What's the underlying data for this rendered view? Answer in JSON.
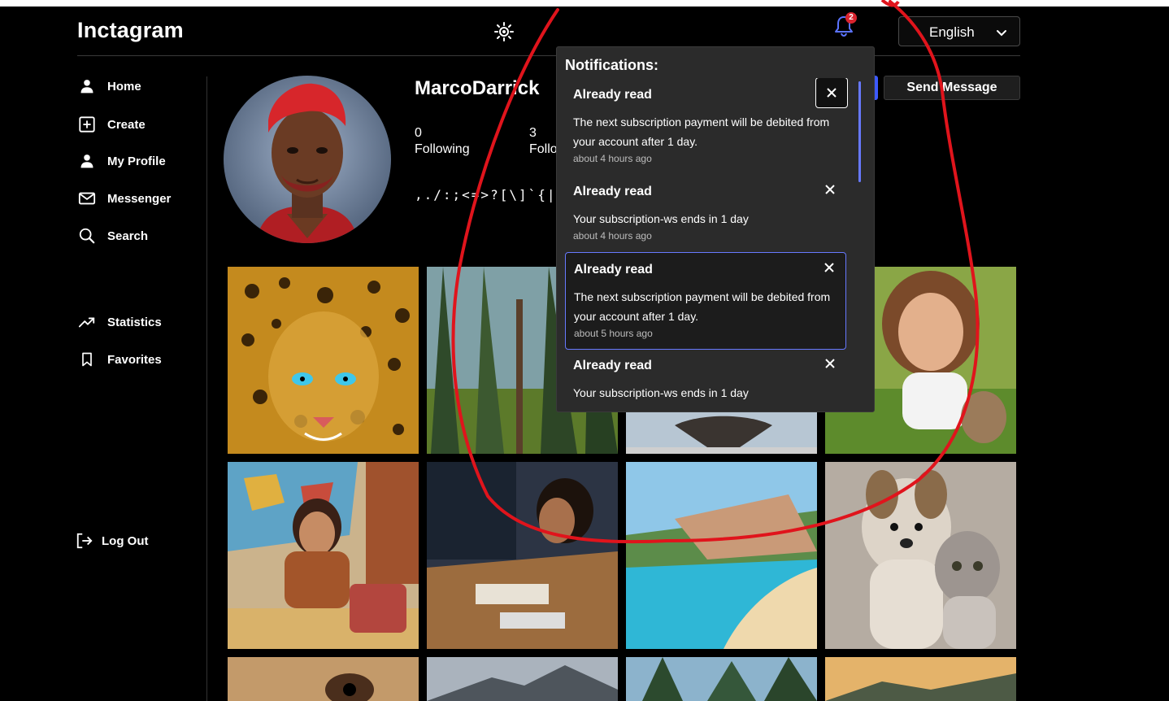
{
  "app": {
    "name": "Inctagram"
  },
  "header": {
    "theme_icon": "sun-icon",
    "notifications_count": "2",
    "language": "English"
  },
  "sidebar": {
    "items": [
      {
        "label": "Home",
        "icon": "person-icon"
      },
      {
        "label": "Create",
        "icon": "plus-square-icon"
      },
      {
        "label": "My Profile",
        "icon": "person-icon"
      },
      {
        "label": "Messenger",
        "icon": "mail-icon"
      },
      {
        "label": "Search",
        "icon": "search-icon"
      },
      {
        "label": "Statistics",
        "icon": "trending-up-icon"
      },
      {
        "label": "Favorites",
        "icon": "bookmark-icon"
      }
    ],
    "logout": {
      "label": "Log Out",
      "icon": "logout-icon"
    }
  },
  "profile": {
    "username": "MarcoDarrick",
    "following_count": "0",
    "following_label": "Following",
    "followers_count": "3",
    "followers_label": "Followers",
    "bio": ",./:;<=>?[\\]`{|}",
    "send_message": "Send Message"
  },
  "notifications": {
    "title": "Notifications:",
    "items": [
      {
        "title": "Already read",
        "body": "The next subscription payment will be debited from your account after 1 day.",
        "time": "about 4 hours ago"
      },
      {
        "title": "Already read",
        "body": "Your subscription-ws ends in 1 day",
        "time": "about 4 hours ago"
      },
      {
        "title": "Already read",
        "body": "The next subscription payment will be debited from your account after 1 day.",
        "time": "about 5 hours ago"
      },
      {
        "title": "Already read",
        "body": "Your subscription-ws ends in 1 day",
        "time": ""
      }
    ]
  },
  "colors": {
    "accent": "#6779ff",
    "badge": "#d9242e",
    "annotation": "#e0141c"
  }
}
